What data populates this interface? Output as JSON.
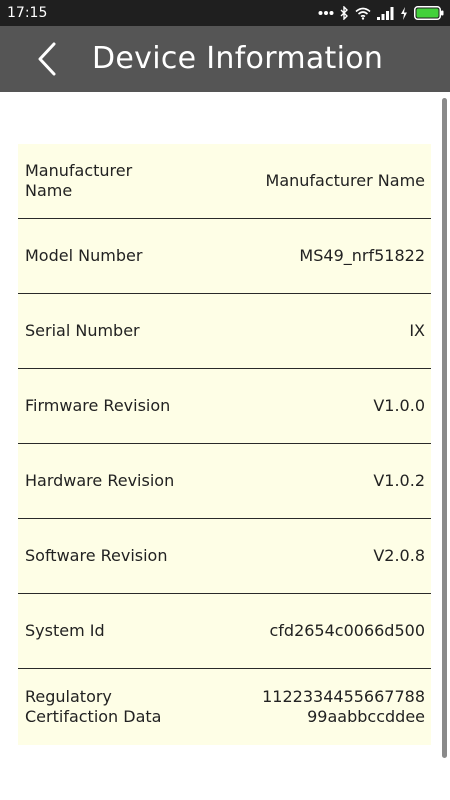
{
  "status_bar": {
    "time": "17:15",
    "icons": [
      "more-dots-icon",
      "bluetooth-icon",
      "wifi-icon",
      "signal-icon",
      "charging-icon",
      "battery-icon"
    ],
    "battery_color": "#43d13b"
  },
  "app_bar": {
    "title": "Device Information",
    "back_icon": "chevron-left-icon",
    "background": "#555555"
  },
  "list": {
    "background": "#fefee6",
    "rows": [
      {
        "label": "Manufacturer\nName",
        "value": "Manufacturer Name"
      },
      {
        "label": "Model Number",
        "value": "MS49_nrf51822"
      },
      {
        "label": "Serial Number",
        "value": "IX"
      },
      {
        "label": "Firmware Revision",
        "value": "V1.0.0"
      },
      {
        "label": "Hardware Revision",
        "value": "V1.0.2"
      },
      {
        "label": "Software Revision",
        "value": "V2.0.8"
      },
      {
        "label": "System Id",
        "value": "cfd2654c0066d500"
      },
      {
        "label": "Regulatory\nCertifaction Data",
        "value": "1122334455667788\n99aabbccddee"
      }
    ]
  }
}
